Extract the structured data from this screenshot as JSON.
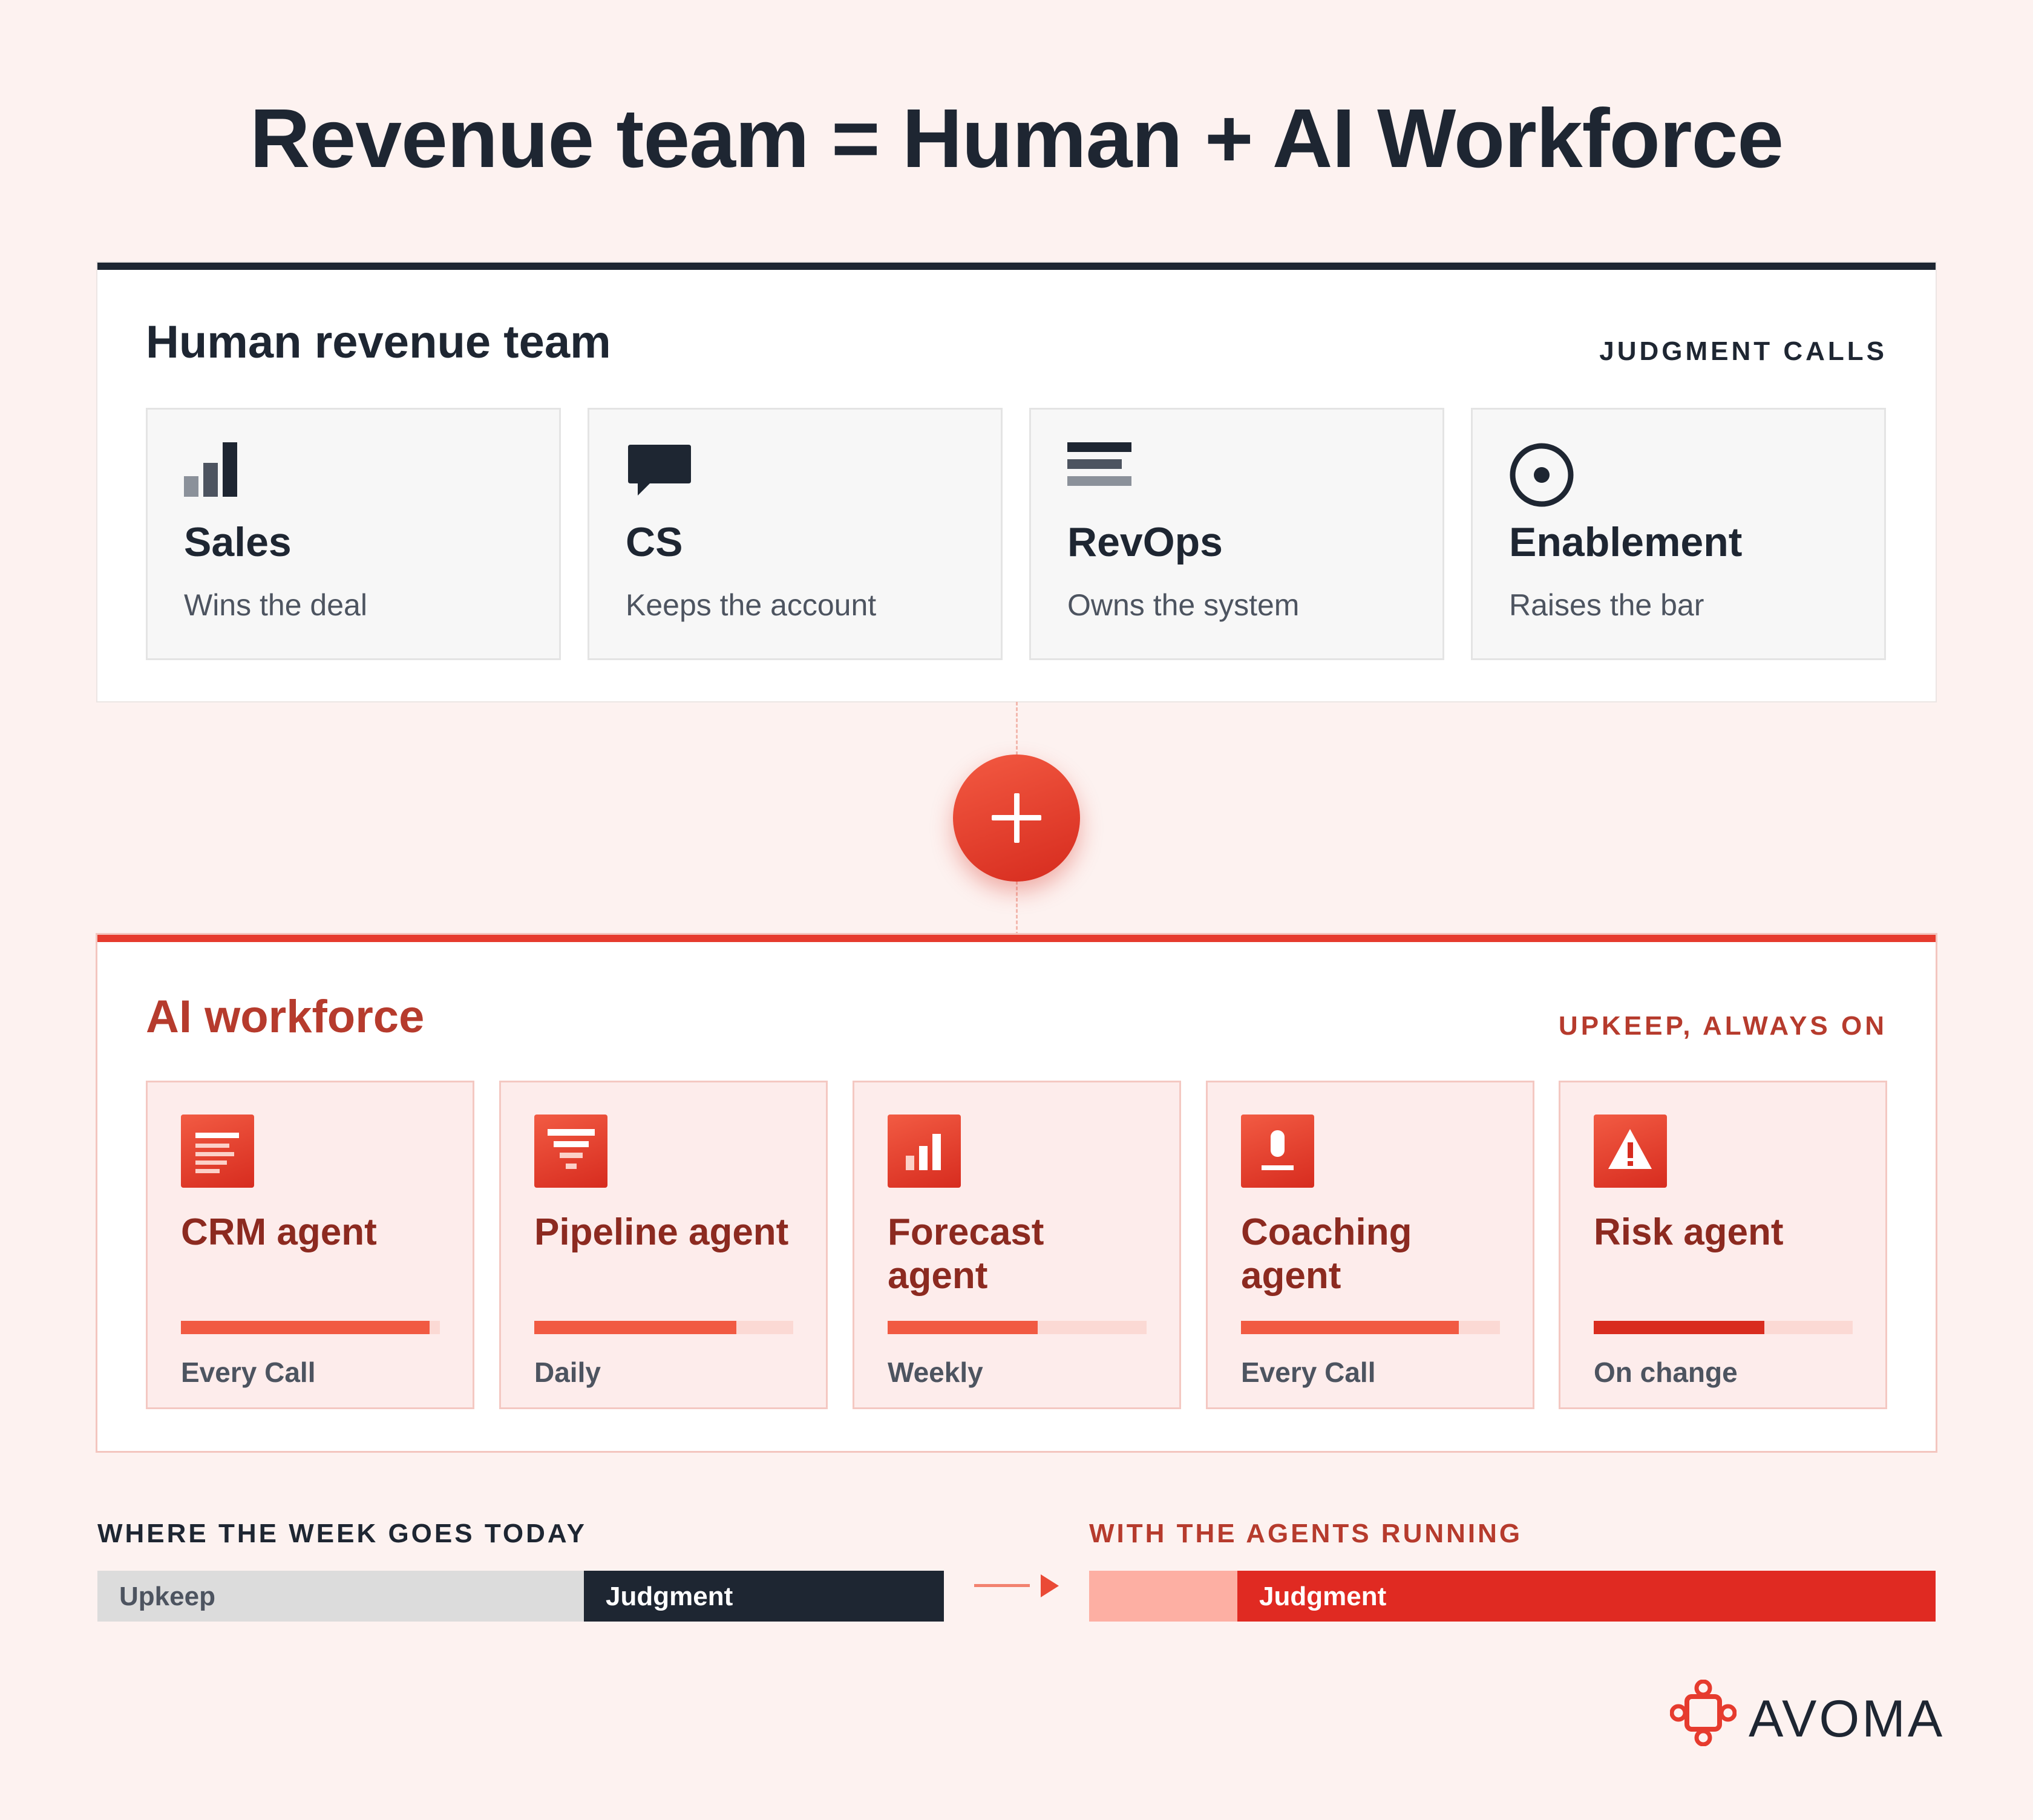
{
  "title": "Revenue team = Human + AI Workforce",
  "human_panel": {
    "title": "Human revenue team",
    "tag": "JUDGMENT CALLS",
    "cards": [
      {
        "icon": "bar-chart-icon",
        "name": "Sales",
        "desc": "Wins the deal"
      },
      {
        "icon": "chat-bubble-icon",
        "name": "CS",
        "desc": "Keeps the account"
      },
      {
        "icon": "stacked-lines-icon",
        "name": "RevOps",
        "desc": "Owns the system"
      },
      {
        "icon": "target-icon",
        "name": "Enablement",
        "desc": "Raises the bar"
      }
    ]
  },
  "connector": {
    "icon": "plus-icon"
  },
  "ai_panel": {
    "title": "AI workforce",
    "tag": "UPKEEP, ALWAYS ON",
    "cards": [
      {
        "icon": "document-icon",
        "name": "CRM agent",
        "frequency": "Every Call",
        "level": 0.96
      },
      {
        "icon": "funnel-icon",
        "name": "Pipeline agent",
        "frequency": "Daily",
        "level": 0.78
      },
      {
        "icon": "bar-chart-icon",
        "name": "Forecast agent",
        "frequency": "Weekly",
        "level": 0.58
      },
      {
        "icon": "person-icon",
        "name": "Coaching agent",
        "frequency": "Every Call",
        "level": 0.84
      },
      {
        "icon": "warning-icon",
        "name": "Risk agent",
        "frequency": "On change",
        "level": 0.66
      }
    ]
  },
  "comparison": {
    "today": {
      "label": "WHERE THE WEEK GOES TODAY",
      "segments": [
        {
          "label": "Upkeep",
          "share": 0.575
        },
        {
          "label": "Judgment",
          "share": 0.425
        }
      ]
    },
    "with_agents": {
      "label": "WITH THE AGENTS RUNNING",
      "segments": [
        {
          "label": "",
          "share": 0.175
        },
        {
          "label": "Judgment",
          "share": 0.825
        }
      ]
    }
  },
  "logo": {
    "text": "AVOMA"
  },
  "colors": {
    "dark": "#1e2632",
    "accent": "#e63b2e",
    "accent_text": "#b63b2d",
    "upkeep_today": "#dcdcdc",
    "upkeep_agents": "#fdafa3",
    "judgment_agents": "#e02a22"
  }
}
